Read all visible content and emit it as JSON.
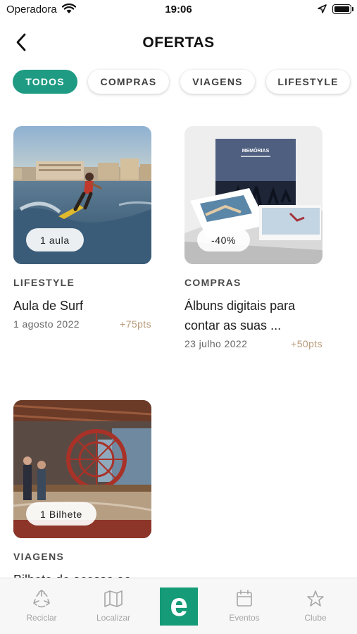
{
  "status_bar": {
    "carrier": "Operadora",
    "time": "19:06"
  },
  "header": {
    "title": "OFERTAS"
  },
  "filters": [
    {
      "label": "TODOS",
      "active": true
    },
    {
      "label": "COMPRAS",
      "active": false
    },
    {
      "label": "VIAGENS",
      "active": false
    },
    {
      "label": "LIFESTYLE",
      "active": false
    }
  ],
  "offers": [
    {
      "badge": "1 aula",
      "category": "LIFESTYLE",
      "title": "Aula de Surf",
      "date": "1 agosto 2022",
      "points": "+75pts"
    },
    {
      "badge": "-40%",
      "category": "COMPRAS",
      "title": "Álbuns digitais para contar as suas ...",
      "date": "23 julho 2022",
      "points": "+50pts",
      "image_text": "MEMÓRIAS"
    },
    {
      "badge": "1 Bilhete",
      "category": "VIAGENS",
      "title": "Bilhete de acesso ao"
    }
  ],
  "tab_bar": {
    "items": [
      {
        "label": "Reciclar",
        "icon": "recycle-icon"
      },
      {
        "label": "Localizar",
        "icon": "map-icon"
      },
      {
        "label": "",
        "icon": "home-logo"
      },
      {
        "label": "Eventos",
        "icon": "calendar-icon"
      },
      {
        "label": "Clube",
        "icon": "star-icon"
      }
    ],
    "logo_letter": "e"
  },
  "colors": {
    "accent": "#1f9b84",
    "points": "#b79a78",
    "logo_bg": "#159b77"
  }
}
